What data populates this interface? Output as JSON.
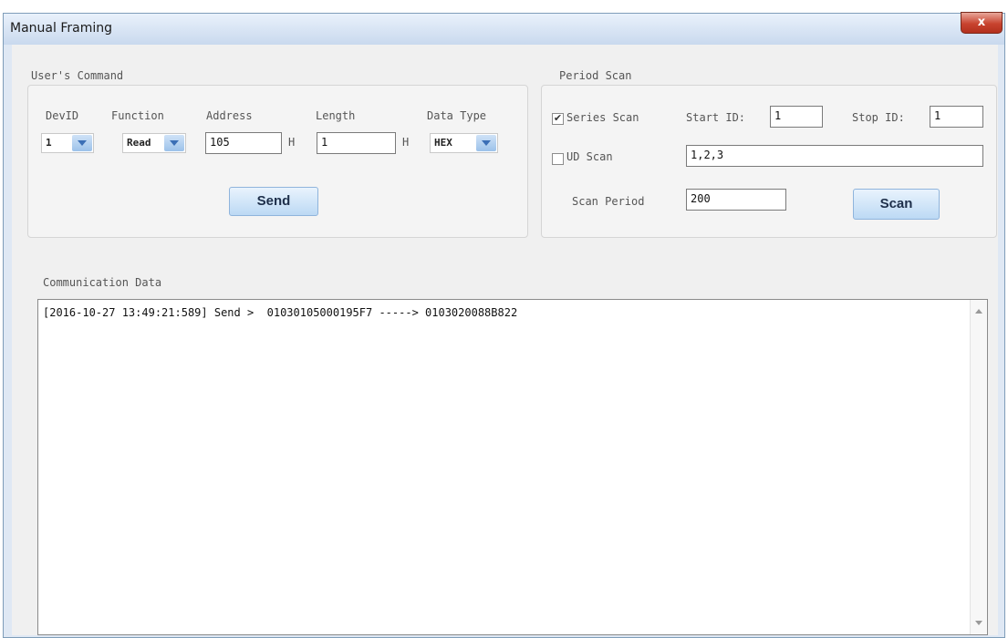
{
  "window": {
    "title": "Manual Framing",
    "close_glyph": "x"
  },
  "user_command": {
    "group_label": "User's Command",
    "labels": {
      "devid": "DevID",
      "function": "Function",
      "address": "Address",
      "length": "Length",
      "data_type": "Data Type"
    },
    "devid_value": "1",
    "function_value": "Read",
    "address_value": "105",
    "address_unit": "H",
    "length_value": "1",
    "length_unit": "H",
    "data_type_value": "HEX",
    "send_label": "Send"
  },
  "period_scan": {
    "group_label": "Period Scan",
    "series_scan_label": "Series Scan",
    "series_scan_checked": true,
    "start_id_label": "Start ID:",
    "start_id_value": "1",
    "stop_id_label": "Stop ID:",
    "stop_id_value": "1",
    "ud_scan_label": "UD Scan",
    "ud_scan_checked": false,
    "ud_scan_value": "1,2,3",
    "scan_period_label": "Scan Period",
    "scan_period_value": "200",
    "scan_label": "Scan"
  },
  "communication": {
    "label": "Communication Data",
    "lines": [
      "[2016-10-27 13:49:21:589] Send >  01030105000195F7 -----> 0103020088B822"
    ]
  },
  "icons": {
    "checked_mark": "✔",
    "close": "close-icon",
    "dropdown": "chevron-down-icon"
  }
}
